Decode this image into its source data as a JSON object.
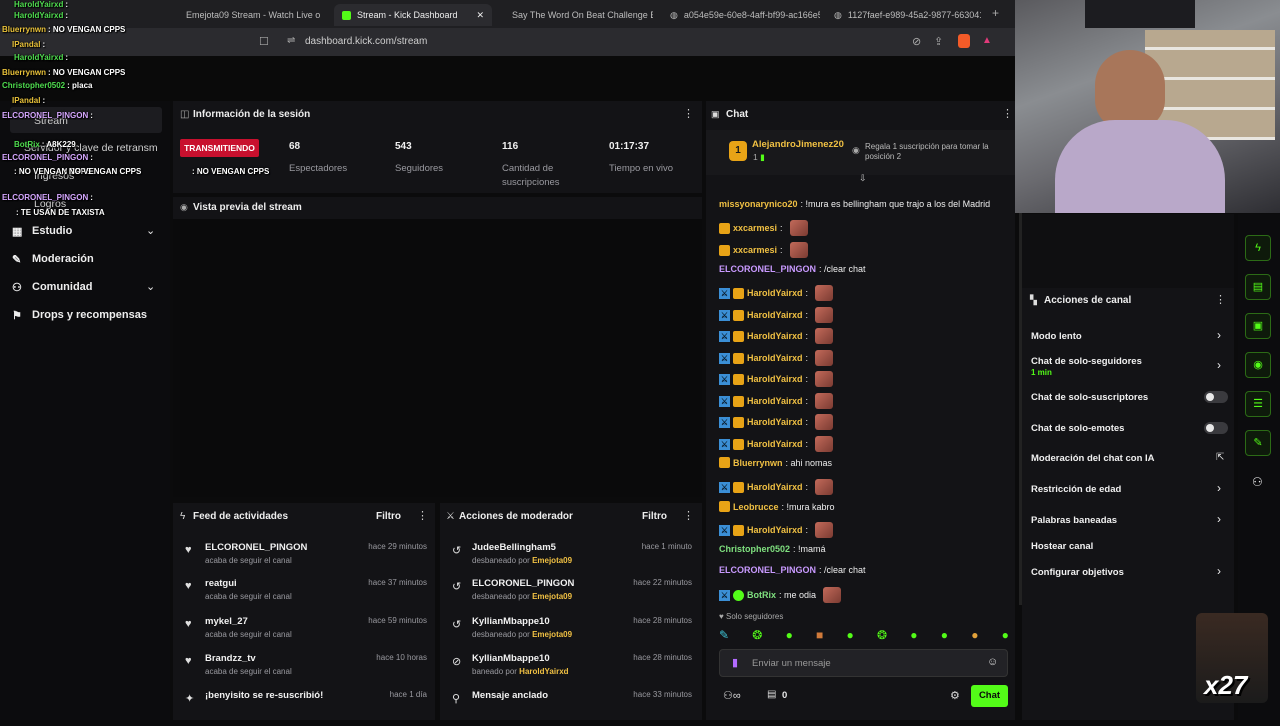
{
  "browser": {
    "tabs": [
      {
        "label": "Emejota09 Stream - Watch Live o",
        "active": false,
        "icon": "kick-icon"
      },
      {
        "label": "Stream - Kick Dashboard",
        "active": true,
        "icon": "kick-icon"
      },
      {
        "label": "Say The Word On Beat Challenge EN",
        "active": false,
        "icon": "youtube-icon"
      },
      {
        "label": "a054e59e-60e8-4aff-bf99-ac166e5",
        "active": false,
        "icon": "globe-icon"
      },
      {
        "label": "1127faef-e989-45a2-9877-6630414e",
        "active": false,
        "icon": "globe-icon"
      }
    ],
    "url": "dashboard.kick.com/stream"
  },
  "sidebar": {
    "items": [
      {
        "label": "Stream"
      },
      {
        "label": "Servidor y clave de retransm"
      },
      {
        "label": "Ingresos"
      },
      {
        "label": "Logros"
      },
      {
        "label": "Estudio"
      },
      {
        "label": "Moderación"
      },
      {
        "label": "Comunidad"
      },
      {
        "label": "Drops y recompensas"
      }
    ]
  },
  "session": {
    "title": "Información de la sesión",
    "status": "TRANSMITIENDO",
    "stats": [
      {
        "value": "68",
        "label": "Espectadores"
      },
      {
        "value": "543",
        "label": "Seguidores"
      },
      {
        "value": "116",
        "label": "Cantidad de suscripciones"
      },
      {
        "value": "01:17:37",
        "label": "Tiempo en vivo"
      }
    ]
  },
  "preview": {
    "title": "Vista previa del stream"
  },
  "activity_feed": {
    "title": "Feed de actividades",
    "filter": "Filtro",
    "items": [
      {
        "name": "ELCORONEL_PINGON",
        "sub": "acaba de seguir el canal",
        "time": "hace 29 minutos",
        "icon": "heart-icon"
      },
      {
        "name": "reatgui",
        "sub": "acaba de seguir el canal",
        "time": "hace 37 minutos",
        "icon": "heart-icon"
      },
      {
        "name": "mykel_27",
        "sub": "acaba de seguir el canal",
        "time": "hace 59 minutos",
        "icon": "heart-icon"
      },
      {
        "name": "Brandzz_tv",
        "sub": "acaba de seguir el canal",
        "time": "hace 10 horas",
        "icon": "heart-icon"
      },
      {
        "name": "¡benyisito se re-suscribió!",
        "sub": "",
        "time": "hace 1 día",
        "icon": "star-icon"
      }
    ]
  },
  "mod_actions": {
    "title": "Acciones de moderador",
    "filter": "Filtro",
    "items": [
      {
        "name": "JudeeBellingham5",
        "sub": "desbaneado por",
        "by": "Emejota09",
        "time": "hace 1 minuto",
        "icon": "undo-icon"
      },
      {
        "name": "ELCORONEL_PINGON",
        "sub": "desbaneado por",
        "by": "Emejota09",
        "time": "hace 22 minutos",
        "icon": "undo-icon"
      },
      {
        "name": "KyllianMbappe10",
        "sub": "desbaneado por",
        "by": "Emejota09",
        "time": "hace 28 minutos",
        "icon": "undo-icon"
      },
      {
        "name": "KyllianMbappe10",
        "sub": "baneado por",
        "by": "HaroldYairxd",
        "time": "hace 28 minutos",
        "icon": "ban-icon"
      },
      {
        "name": "Mensaje anclado",
        "sub": "",
        "by": "",
        "time": "hace 33 minutos",
        "icon": "pin-icon"
      }
    ]
  },
  "chat": {
    "title": "Chat",
    "top_gifter": {
      "name": "AlejandroJimenez20",
      "count": "1",
      "note": "Regala 1 suscripción para tomar la posición 2"
    },
    "messages": [
      {
        "user": "missyonarynico20",
        "color": "gold",
        "text": ": !mura es bellingham que trajo a los del Madrid",
        "badges": [],
        "emote": false
      },
      {
        "user": "xxcarmesi",
        "color": "gold",
        "text": ":",
        "badges": [
          "crown"
        ],
        "emote": true
      },
      {
        "user": "xxcarmesi",
        "color": "gold",
        "text": ":",
        "badges": [
          "crown"
        ],
        "emote": true
      },
      {
        "user": "ELCORONEL_PINGON",
        "color": "purple",
        "text": ": /clear chat",
        "badges": [],
        "emote": false
      },
      {
        "user": "HaroldYairxd",
        "color": "gold",
        "text": ":",
        "badges": [
          "mod",
          "crown"
        ],
        "emote": true
      },
      {
        "user": "HaroldYairxd",
        "color": "gold",
        "text": ":",
        "badges": [
          "mod",
          "crown"
        ],
        "emote": true
      },
      {
        "user": "HaroldYairxd",
        "color": "gold",
        "text": ":",
        "badges": [
          "mod",
          "crown"
        ],
        "emote": true
      },
      {
        "user": "HaroldYairxd",
        "color": "gold",
        "text": ":",
        "badges": [
          "mod",
          "crown"
        ],
        "emote": true
      },
      {
        "user": "HaroldYairxd",
        "color": "gold",
        "text": ":",
        "badges": [
          "mod",
          "crown"
        ],
        "emote": true
      },
      {
        "user": "HaroldYairxd",
        "color": "gold",
        "text": ":",
        "badges": [
          "mod",
          "crown"
        ],
        "emote": true
      },
      {
        "user": "HaroldYairxd",
        "color": "gold",
        "text": ":",
        "badges": [
          "mod",
          "crown"
        ],
        "emote": true
      },
      {
        "user": "HaroldYairxd",
        "color": "gold",
        "text": ":",
        "badges": [
          "mod",
          "crown"
        ],
        "emote": true
      },
      {
        "user": "Bluerrynwn",
        "color": "gold",
        "text": ": ahi nomas",
        "badges": [
          "crown"
        ],
        "emote": false
      },
      {
        "user": "HaroldYairxd",
        "color": "gold",
        "text": ":",
        "badges": [
          "mod",
          "crown"
        ],
        "emote": true
      },
      {
        "user": "Leobrucce",
        "color": "gold",
        "text": ": !mura kabro",
        "badges": [
          "crown"
        ],
        "emote": false
      },
      {
        "user": "HaroldYairxd",
        "color": "gold",
        "text": ":",
        "badges": [
          "mod",
          "crown"
        ],
        "emote": true
      },
      {
        "user": "Christopher0502",
        "color": "green",
        "text": ": !mamá",
        "badges": [],
        "emote": false
      },
      {
        "user": "ELCORONEL_PINGON",
        "color": "purple",
        "text": ": /clear chat",
        "badges": [],
        "emote": false
      },
      {
        "user": "BotRix",
        "color": "green",
        "text": ": me odia",
        "badges": [
          "mod",
          "verified"
        ],
        "emote": true
      }
    ],
    "mode_label": "Solo seguidores",
    "input_placeholder": "Enviar un mensaje",
    "bottom_count": "0",
    "send_label": "Chat"
  },
  "channel_actions": {
    "title": "Acciones de canal",
    "items": [
      {
        "label": "Modo lento",
        "sub": "",
        "control": "chevron"
      },
      {
        "label": "Chat de solo-seguidores",
        "sub": "1 min",
        "control": "chevron"
      },
      {
        "label": "Chat de solo-suscriptores",
        "sub": "",
        "control": "toggle"
      },
      {
        "label": "Chat de solo-emotes",
        "sub": "",
        "control": "toggle"
      },
      {
        "label": "Moderación del chat con IA",
        "sub": "",
        "control": "external"
      },
      {
        "label": "Restricción de edad",
        "sub": "",
        "control": "chevron"
      },
      {
        "label": "Palabras baneadas",
        "sub": "",
        "control": "chevron"
      },
      {
        "label": "Hostear canal",
        "sub": "",
        "control": "none"
      },
      {
        "label": "Configurar objetivos",
        "sub": "",
        "control": "chevron"
      }
    ]
  },
  "overlay_chat": [
    {
      "user": "HaroldYairxd",
      "text": ":",
      "cls": "on"
    },
    {
      "user": "HaroldYairxd",
      "text": ":",
      "cls": "on"
    },
    {
      "user": "Bluerrynwn",
      "text": ": NO VENGAN CPPS",
      "cls": "oy"
    },
    {
      "user": "IPandal",
      "text": ":",
      "cls": "oy"
    },
    {
      "user": "HaroldYairxd",
      "text": ":",
      "cls": "on"
    },
    {
      "user": "Bluerrynwn",
      "text": ": NO VENGAN CPPS",
      "cls": "oy"
    },
    {
      "user": "Christopher0502",
      "text": ": placa",
      "cls": "on"
    },
    {
      "user": "IPandal",
      "text": ":",
      "cls": "oy"
    },
    {
      "user": "ELCORONEL_PINGON",
      "text": ":",
      "cls": "op"
    },
    {
      "user": "BotRix",
      "text": ": A8K229",
      "cls": "on"
    },
    {
      "user": "ELCORONEL_PINGON",
      "text": ":",
      "cls": "op"
    },
    {
      "user": "",
      "text": ": NO VENGAN CPPS",
      "cls": "ob"
    },
    {
      "user": "",
      "text": ": NO VENGAN CPPS",
      "cls": "oy"
    },
    {
      "user": "",
      "text": ": NO VENGAN CPPS",
      "cls": "oy"
    },
    {
      "user": "ELCORONEL_PINGON",
      "text": ":",
      "cls": "op"
    },
    {
      "user": "",
      "text": ": TE USAN DE TAXISTA",
      "cls": "ored"
    }
  ],
  "overlay_badge": "x27",
  "colors": {
    "kick_green": "#53fc18",
    "live_red": "#c8102e",
    "mod_blue": "#3b8fd6",
    "crown_gold": "#e8a316"
  }
}
